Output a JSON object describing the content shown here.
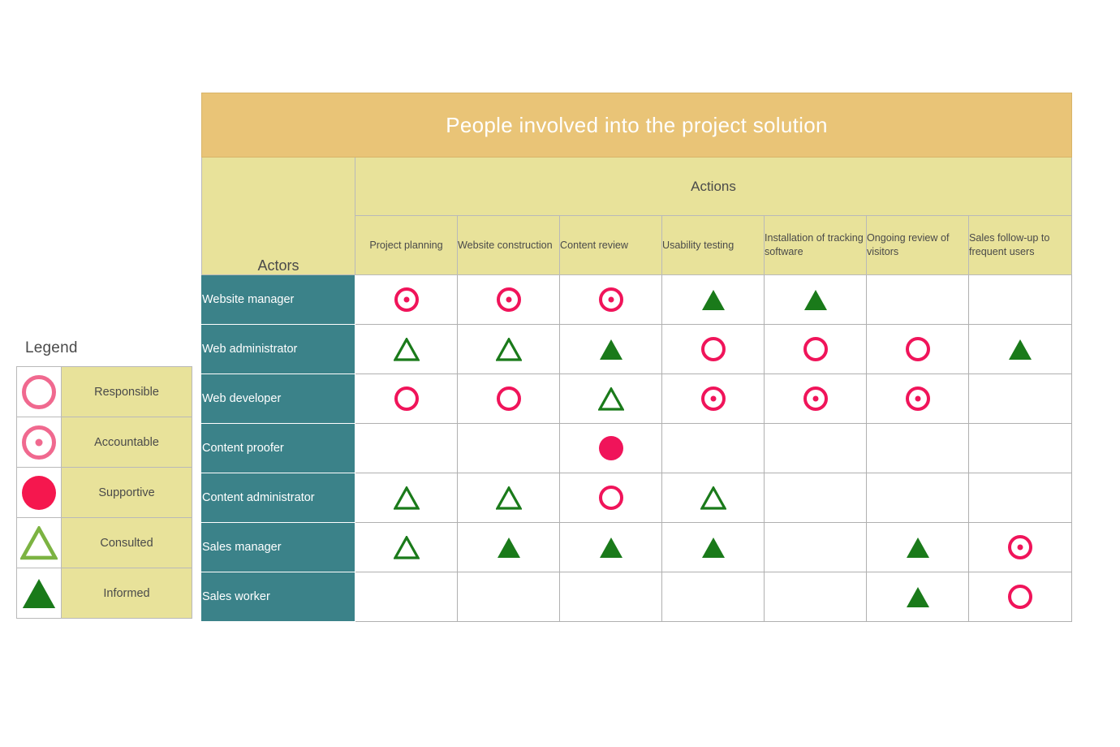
{
  "title": "People involved into the project solution",
  "colors": {
    "title_bar": "#E9C477",
    "header": "#E8E29A",
    "actor_column": "#3B8289",
    "crimson": "#F0145A",
    "green": "#1A7A1A",
    "legend_pink": "#F0698F",
    "legend_green": "#7CB342"
  },
  "legend": {
    "title": "Legend",
    "items": [
      {
        "symbol": "responsible",
        "label": "Responsible"
      },
      {
        "symbol": "accountable",
        "label": "Accountable"
      },
      {
        "symbol": "supportive",
        "label": "Supportive"
      },
      {
        "symbol": "consulted",
        "label": "Consulted"
      },
      {
        "symbol": "informed",
        "label": "Informed"
      }
    ]
  },
  "matrix": {
    "actors_header": "Actors",
    "actions_header": "Actions",
    "columns": [
      "Project planning",
      "Website construction",
      "Content review",
      "Usability testing",
      "Installation of tracking software",
      "Ongoing review of visitors",
      "Sales follow-up to frequent users"
    ],
    "rows": [
      {
        "actor": "Website manager",
        "cells": [
          "accountable",
          "accountable",
          "accountable",
          "informed",
          "informed",
          "",
          ""
        ]
      },
      {
        "actor": "Web administrator",
        "cells": [
          "consulted",
          "consulted",
          "informed",
          "responsible",
          "responsible",
          "responsible",
          "informed"
        ]
      },
      {
        "actor": "Web developer",
        "cells": [
          "responsible",
          "responsible",
          "consulted",
          "accountable",
          "accountable",
          "accountable",
          ""
        ]
      },
      {
        "actor": "Content proofer",
        "cells": [
          "",
          "",
          "supportive",
          "",
          "",
          "",
          ""
        ]
      },
      {
        "actor": "Content administrator",
        "cells": [
          "consulted",
          "consulted",
          "responsible",
          "consulted",
          "",
          "",
          ""
        ]
      },
      {
        "actor": "Sales manager",
        "cells": [
          "consulted",
          "informed",
          "informed",
          "informed",
          "",
          "informed",
          "accountable"
        ]
      },
      {
        "actor": "Sales worker",
        "cells": [
          "",
          "",
          "",
          "",
          "",
          "informed",
          "responsible"
        ]
      }
    ]
  }
}
